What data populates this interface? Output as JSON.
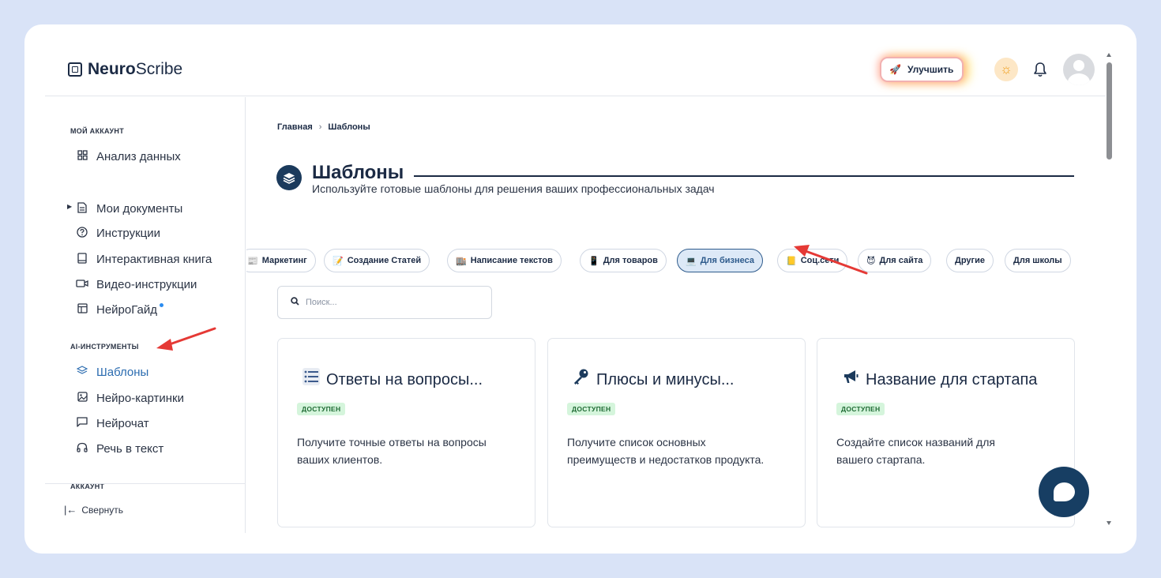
{
  "app": {
    "brand_bold": "Neuro",
    "brand_rest": "Scribe"
  },
  "header": {
    "upgrade_label": "Улучшить"
  },
  "sidebar": {
    "section_account": "МОЙ АККАУНТ",
    "account_items": [
      {
        "label": "Анализ данных",
        "icon": "grid-icon"
      },
      {
        "label": "Мои документы",
        "icon": "document-icon"
      },
      {
        "label": "Инструкции",
        "icon": "help-circle-icon"
      },
      {
        "label": "Интерактивная книга",
        "icon": "book-icon"
      },
      {
        "label": "Видео-инструкции",
        "icon": "video-icon"
      },
      {
        "label": "НейроГайд",
        "icon": "table-icon"
      }
    ],
    "section_ai": "AI-ИНСТРУМЕНТЫ",
    "ai_items": [
      {
        "label": "Шаблоны",
        "icon": "layers-icon"
      },
      {
        "label": "Нейро-картинки",
        "icon": "image-icon"
      },
      {
        "label": "Нейрочат",
        "icon": "chat-icon"
      },
      {
        "label": "Речь в текст",
        "icon": "headphones-icon"
      }
    ],
    "section_account2": "АККАУНТ",
    "collapse_label": "Свернуть"
  },
  "main": {
    "breadcrumb": [
      "Главная",
      "Шаблоны"
    ],
    "title": "Шаблоны",
    "subtitle": "Используйте готовые шаблоны для решения ваших профессиональных задач",
    "categories": [
      {
        "label": "Маркетинг",
        "emoji": "📰"
      },
      {
        "label": "Создание Статей",
        "emoji": "📝"
      },
      {
        "label": "Написание текстов",
        "emoji": "🏬"
      },
      {
        "label": "Для товаров",
        "emoji": "📱"
      },
      {
        "label": "Для бизнеса",
        "emoji": "💻"
      },
      {
        "label": "Соц.сети",
        "emoji": "📒"
      },
      {
        "label": "Для сайта",
        "emoji": "😈"
      },
      {
        "label": "Другие",
        "emoji": ""
      },
      {
        "label": "Для школы",
        "emoji": ""
      }
    ],
    "active_category": "Для бизнеса",
    "search_placeholder": "Поиск...",
    "cards": [
      {
        "icon": "☰",
        "title": "Ответы на вопросы...",
        "badge": "ДОСТУПЕН",
        "desc": "Получите точные ответы на вопросы ваших клиентов."
      },
      {
        "icon": "🔑",
        "title": "Плюсы и минусы...",
        "badge": "ДОСТУПЕН",
        "desc": "Получите список основных преимуществ и недостатков продукта."
      },
      {
        "icon": "📢",
        "title": "Название для стартапа",
        "badge": "ДОСТУПЕН",
        "desc": "Создайте список названий для вашего стартапа."
      }
    ]
  },
  "colors": {
    "accent": "#2b6cb0",
    "annotation_arrow": "#e53935",
    "chat_button": "#173e63"
  }
}
